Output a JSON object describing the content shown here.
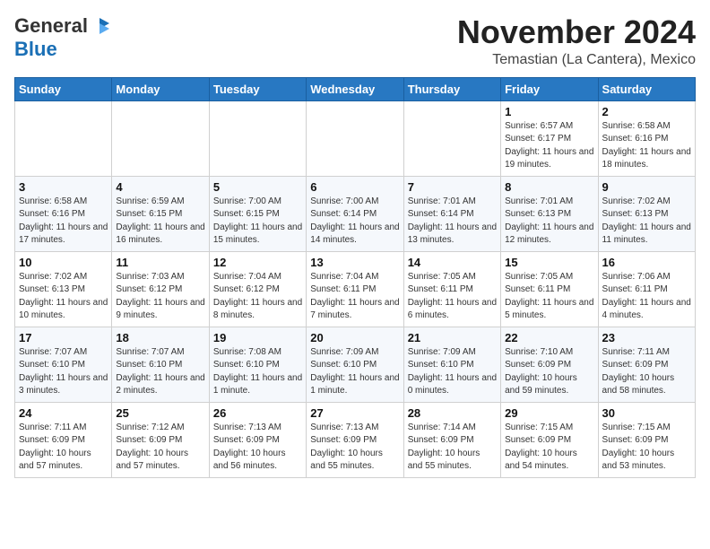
{
  "header": {
    "logo_general": "General",
    "logo_blue": "Blue",
    "main_title": "November 2024",
    "subtitle": "Temastian (La Cantera), Mexico"
  },
  "days_of_week": [
    "Sunday",
    "Monday",
    "Tuesday",
    "Wednesday",
    "Thursday",
    "Friday",
    "Saturday"
  ],
  "weeks": [
    [
      {
        "day": "",
        "info": ""
      },
      {
        "day": "",
        "info": ""
      },
      {
        "day": "",
        "info": ""
      },
      {
        "day": "",
        "info": ""
      },
      {
        "day": "",
        "info": ""
      },
      {
        "day": "1",
        "info": "Sunrise: 6:57 AM\nSunset: 6:17 PM\nDaylight: 11 hours and 19 minutes."
      },
      {
        "day": "2",
        "info": "Sunrise: 6:58 AM\nSunset: 6:16 PM\nDaylight: 11 hours and 18 minutes."
      }
    ],
    [
      {
        "day": "3",
        "info": "Sunrise: 6:58 AM\nSunset: 6:16 PM\nDaylight: 11 hours and 17 minutes."
      },
      {
        "day": "4",
        "info": "Sunrise: 6:59 AM\nSunset: 6:15 PM\nDaylight: 11 hours and 16 minutes."
      },
      {
        "day": "5",
        "info": "Sunrise: 7:00 AM\nSunset: 6:15 PM\nDaylight: 11 hours and 15 minutes."
      },
      {
        "day": "6",
        "info": "Sunrise: 7:00 AM\nSunset: 6:14 PM\nDaylight: 11 hours and 14 minutes."
      },
      {
        "day": "7",
        "info": "Sunrise: 7:01 AM\nSunset: 6:14 PM\nDaylight: 11 hours and 13 minutes."
      },
      {
        "day": "8",
        "info": "Sunrise: 7:01 AM\nSunset: 6:13 PM\nDaylight: 11 hours and 12 minutes."
      },
      {
        "day": "9",
        "info": "Sunrise: 7:02 AM\nSunset: 6:13 PM\nDaylight: 11 hours and 11 minutes."
      }
    ],
    [
      {
        "day": "10",
        "info": "Sunrise: 7:02 AM\nSunset: 6:13 PM\nDaylight: 11 hours and 10 minutes."
      },
      {
        "day": "11",
        "info": "Sunrise: 7:03 AM\nSunset: 6:12 PM\nDaylight: 11 hours and 9 minutes."
      },
      {
        "day": "12",
        "info": "Sunrise: 7:04 AM\nSunset: 6:12 PM\nDaylight: 11 hours and 8 minutes."
      },
      {
        "day": "13",
        "info": "Sunrise: 7:04 AM\nSunset: 6:11 PM\nDaylight: 11 hours and 7 minutes."
      },
      {
        "day": "14",
        "info": "Sunrise: 7:05 AM\nSunset: 6:11 PM\nDaylight: 11 hours and 6 minutes."
      },
      {
        "day": "15",
        "info": "Sunrise: 7:05 AM\nSunset: 6:11 PM\nDaylight: 11 hours and 5 minutes."
      },
      {
        "day": "16",
        "info": "Sunrise: 7:06 AM\nSunset: 6:11 PM\nDaylight: 11 hours and 4 minutes."
      }
    ],
    [
      {
        "day": "17",
        "info": "Sunrise: 7:07 AM\nSunset: 6:10 PM\nDaylight: 11 hours and 3 minutes."
      },
      {
        "day": "18",
        "info": "Sunrise: 7:07 AM\nSunset: 6:10 PM\nDaylight: 11 hours and 2 minutes."
      },
      {
        "day": "19",
        "info": "Sunrise: 7:08 AM\nSunset: 6:10 PM\nDaylight: 11 hours and 1 minute."
      },
      {
        "day": "20",
        "info": "Sunrise: 7:09 AM\nSunset: 6:10 PM\nDaylight: 11 hours and 1 minute."
      },
      {
        "day": "21",
        "info": "Sunrise: 7:09 AM\nSunset: 6:10 PM\nDaylight: 11 hours and 0 minutes."
      },
      {
        "day": "22",
        "info": "Sunrise: 7:10 AM\nSunset: 6:09 PM\nDaylight: 10 hours and 59 minutes."
      },
      {
        "day": "23",
        "info": "Sunrise: 7:11 AM\nSunset: 6:09 PM\nDaylight: 10 hours and 58 minutes."
      }
    ],
    [
      {
        "day": "24",
        "info": "Sunrise: 7:11 AM\nSunset: 6:09 PM\nDaylight: 10 hours and 57 minutes."
      },
      {
        "day": "25",
        "info": "Sunrise: 7:12 AM\nSunset: 6:09 PM\nDaylight: 10 hours and 57 minutes."
      },
      {
        "day": "26",
        "info": "Sunrise: 7:13 AM\nSunset: 6:09 PM\nDaylight: 10 hours and 56 minutes."
      },
      {
        "day": "27",
        "info": "Sunrise: 7:13 AM\nSunset: 6:09 PM\nDaylight: 10 hours and 55 minutes."
      },
      {
        "day": "28",
        "info": "Sunrise: 7:14 AM\nSunset: 6:09 PM\nDaylight: 10 hours and 55 minutes."
      },
      {
        "day": "29",
        "info": "Sunrise: 7:15 AM\nSunset: 6:09 PM\nDaylight: 10 hours and 54 minutes."
      },
      {
        "day": "30",
        "info": "Sunrise: 7:15 AM\nSunset: 6:09 PM\nDaylight: 10 hours and 53 minutes."
      }
    ]
  ]
}
